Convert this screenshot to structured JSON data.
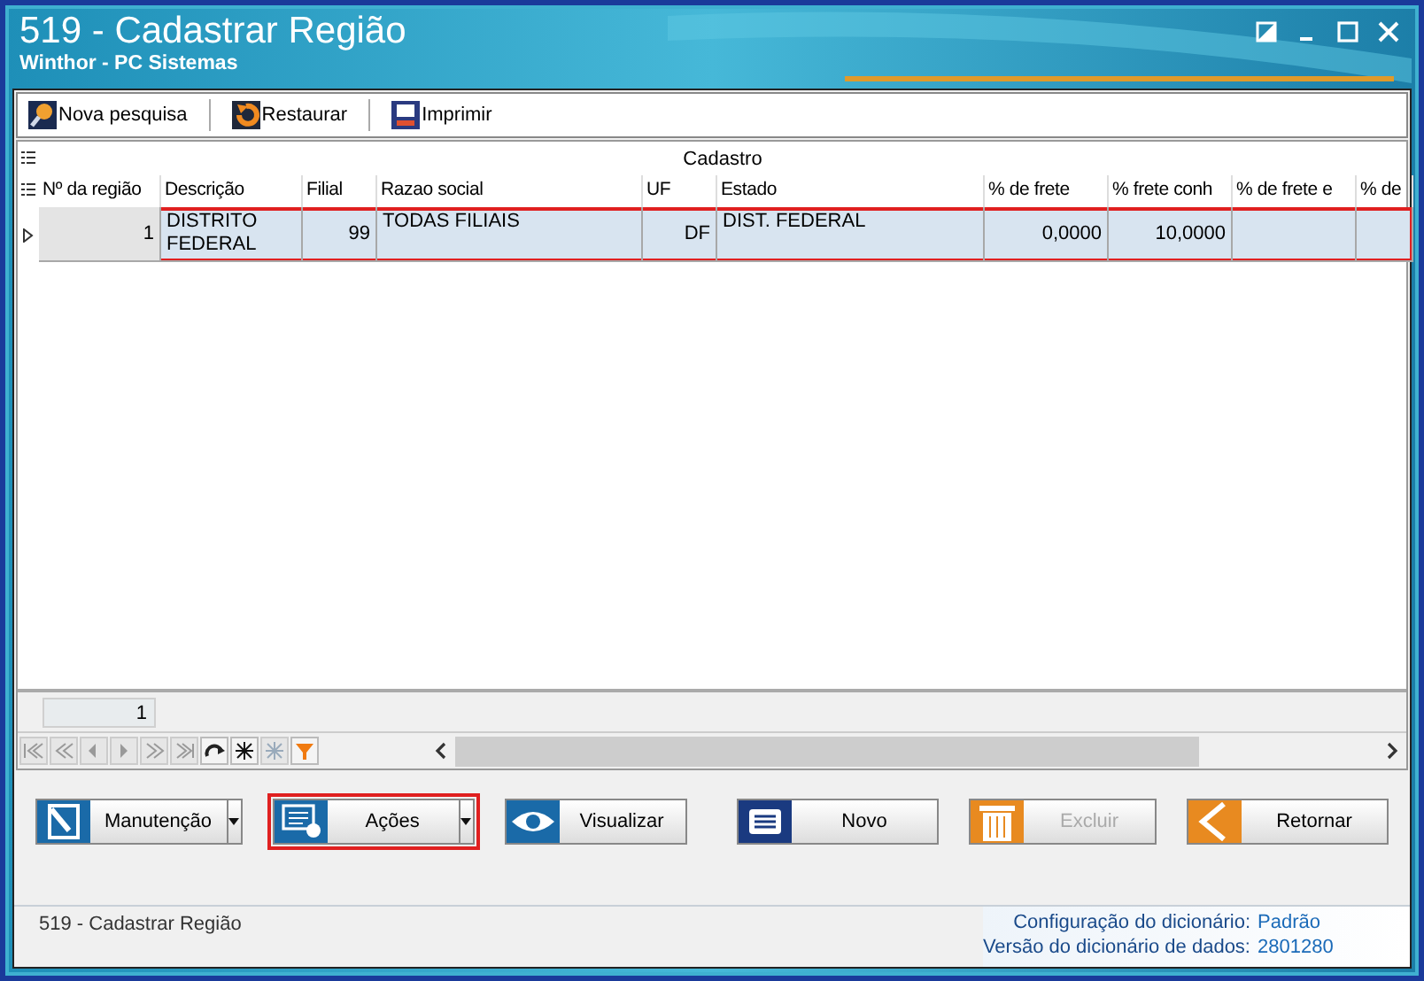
{
  "window": {
    "title": "519 - Cadastrar Região",
    "subtitle": "Winthor - PC Sistemas"
  },
  "toolbar": [
    {
      "kind": "search",
      "label": "Nova pesquisa"
    },
    {
      "kind": "restore",
      "label": "Restaurar"
    },
    {
      "kind": "print",
      "label": "Imprimir"
    }
  ],
  "grid": {
    "band": "Cadastro",
    "columns": [
      {
        "label": "Nº da região"
      },
      {
        "label": "Descrição"
      },
      {
        "label": "Filial"
      },
      {
        "label": "Razao social"
      },
      {
        "label": "UF"
      },
      {
        "label": "Estado"
      },
      {
        "label": "% de frete"
      },
      {
        "label": "% frete conh"
      },
      {
        "label": "% de frete e"
      },
      {
        "label": "% de"
      }
    ],
    "rows": [
      {
        "selected": true,
        "highlighted": true,
        "cells": [
          "1",
          "DISTRITO FEDERAL",
          "99",
          "TODAS FILIAIS",
          "DF",
          "DIST. FEDERAL",
          "0,0000",
          "10,0000",
          "",
          ""
        ]
      }
    ],
    "footer_count": "1"
  },
  "navigator": [
    {
      "kind": "first",
      "disabled": true
    },
    {
      "kind": "prior-page",
      "disabled": true
    },
    {
      "kind": "prior",
      "disabled": true
    },
    {
      "kind": "next",
      "disabled": true
    },
    {
      "kind": "next-page",
      "disabled": true
    },
    {
      "kind": "last",
      "disabled": true
    },
    {
      "kind": "refresh",
      "disabled": false
    },
    {
      "kind": "insert",
      "disabled": false
    },
    {
      "kind": "delete",
      "disabled": true
    },
    {
      "kind": "filter",
      "disabled": false
    }
  ],
  "buttons_left": [
    {
      "kind": "edit",
      "label": "Manutenção",
      "dropdown": true,
      "highlighted": false,
      "disabled": false
    },
    {
      "kind": "actions",
      "label": "Ações",
      "dropdown": true,
      "highlighted": true,
      "disabled": false
    },
    {
      "kind": "view",
      "label": "Visualizar",
      "dropdown": false,
      "highlighted": false,
      "disabled": false
    }
  ],
  "buttons_right": [
    {
      "kind": "new",
      "label": "Novo",
      "disabled": false
    },
    {
      "kind": "delete",
      "label": "Excluir",
      "disabled": true
    },
    {
      "kind": "back",
      "label": "Retornar",
      "disabled": false
    }
  ],
  "status_bar": {
    "text": "519 - Cadastrar Região",
    "info": [
      {
        "label": "Configuração do dicionário:",
        "value": "Padrão"
      },
      {
        "label": "Versão do dicionário de dados:",
        "value": "2801280"
      }
    ]
  }
}
